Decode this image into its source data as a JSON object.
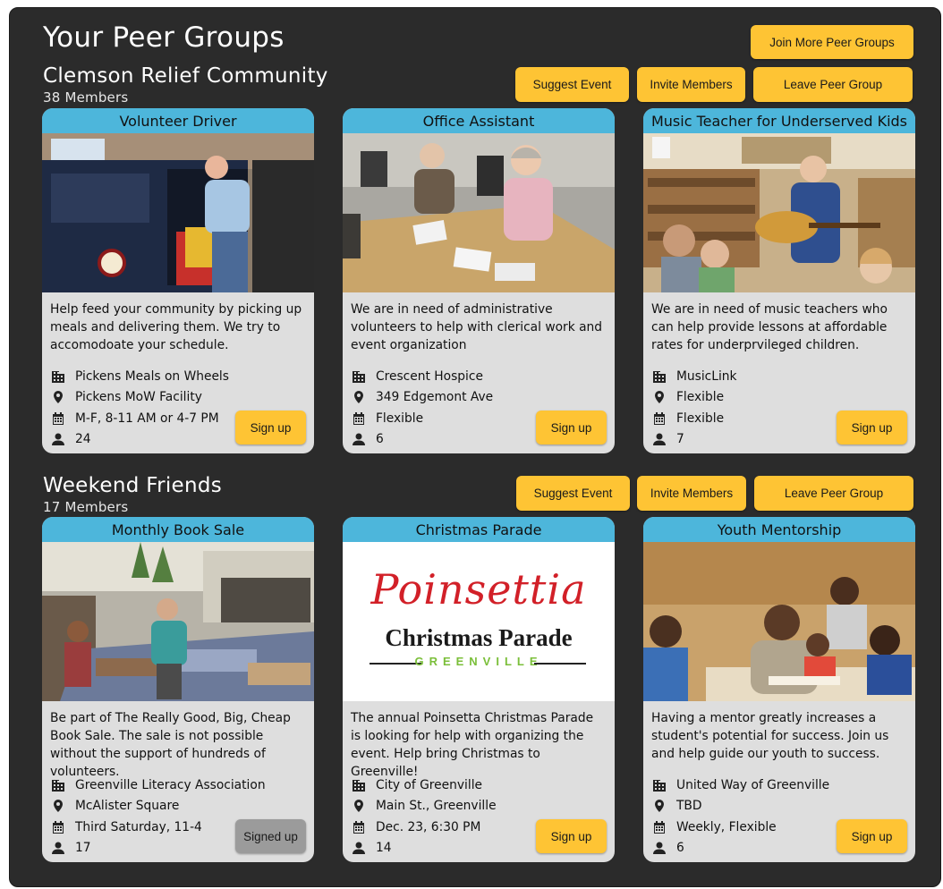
{
  "page": {
    "title": "Your Peer Groups",
    "join_label": "Join More Peer Groups"
  },
  "groups": [
    {
      "name": "Clemson Relief Community",
      "members": "38 Members",
      "actions": {
        "suggest": "Suggest Event",
        "invite": "Invite Members",
        "leave": "Leave Peer Group"
      },
      "cards": [
        {
          "title": "Volunteer Driver",
          "description": "Help feed your community by picking up meals and delivering them. We try to accomodoate your schedule.",
          "organization": "Pickens Meals on Wheels",
          "location": "Pickens MoW Facility",
          "schedule": "M-F, 8-11 AM or 4-7 PM",
          "volunteers": "24",
          "button": "Sign up"
        },
        {
          "title": "Office Assistant",
          "description": "We are in need of administrative volunteers to help with clerical work and event organization",
          "organization": "Crescent Hospice",
          "location": "349 Edgemont Ave",
          "schedule": "Flexible",
          "volunteers": "6",
          "button": "Sign up"
        },
        {
          "title": "Music Teacher for Underserved Kids",
          "description": "We are in need of music teachers who can help provide lessons at affordable rates for underprvileged children.",
          "organization": "MusicLink",
          "location": "Flexible",
          "schedule": "Flexible",
          "volunteers": "7",
          "button": "Sign up"
        }
      ]
    },
    {
      "name": "Weekend Friends",
      "members": "17 Members",
      "actions": {
        "suggest": "Suggest Event",
        "invite": "Invite Members",
        "leave": "Leave Peer Group"
      },
      "cards": [
        {
          "title": "Monthly Book Sale",
          "description": "Be part of The Really Good, Big, Cheap Book Sale. The sale is not possible without the support of hundreds of volunteers.",
          "organization": "Greenville Literacy Association",
          "location": "McAlister Square",
          "schedule": "Third Saturday, 11-4",
          "volunteers": "17",
          "button": "Signed up"
        },
        {
          "title": "Christmas Parade",
          "description": "The annual Poinsetta Christmas Parade is looking for help with organizing the event. Help bring Christmas  to Greenville!",
          "organization": "City of Greenville",
          "location": "Main St., Greenville",
          "schedule": "Dec. 23, 6:30 PM",
          "volunteers": "14",
          "button": "Sign up",
          "logo": {
            "line1": "Poinsettia",
            "line2": "Christmas Parade",
            "line3": "GREENVILLE"
          }
        },
        {
          "title": "Youth Mentorship",
          "description": "Having a mentor greatly increases a student's potential for success. Join us and help guide our youth to success.",
          "organization": "United Way of Greenville",
          "location": "TBD",
          "schedule": "Weekly, Flexible",
          "volunteers": "6",
          "button": "Sign up"
        }
      ]
    }
  ],
  "icons": {
    "organization": "building-icon",
    "location": "location-pin-icon",
    "schedule": "calendar-icon",
    "volunteers": "person-icon"
  },
  "colors": {
    "background": "#2b2b2b",
    "card": "#dedede",
    "card_header": "#4db6db",
    "button": "#fec434",
    "button_disabled": "#9b9b9b"
  }
}
